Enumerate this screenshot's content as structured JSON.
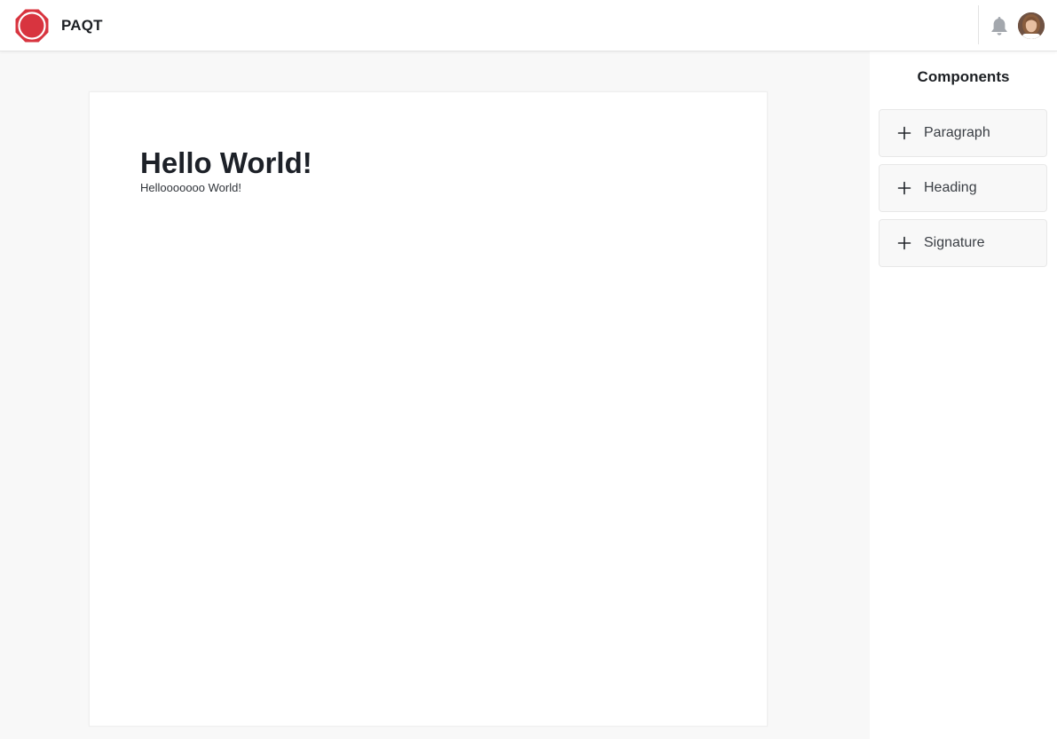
{
  "header": {
    "brand_name": "PAQT",
    "brand_color": "#d8343f",
    "logo_icon": "octagon-badge-icon",
    "notifications_icon": "bell-icon",
    "avatar_icon": "user-avatar"
  },
  "document": {
    "heading": "Hello World!",
    "paragraph": "Hellooooooo World!"
  },
  "components_panel": {
    "title": "Components",
    "items": [
      {
        "label": "Paragraph",
        "icon": "plus-icon"
      },
      {
        "label": "Heading",
        "icon": "plus-icon"
      },
      {
        "label": "Signature",
        "icon": "plus-icon"
      }
    ]
  }
}
